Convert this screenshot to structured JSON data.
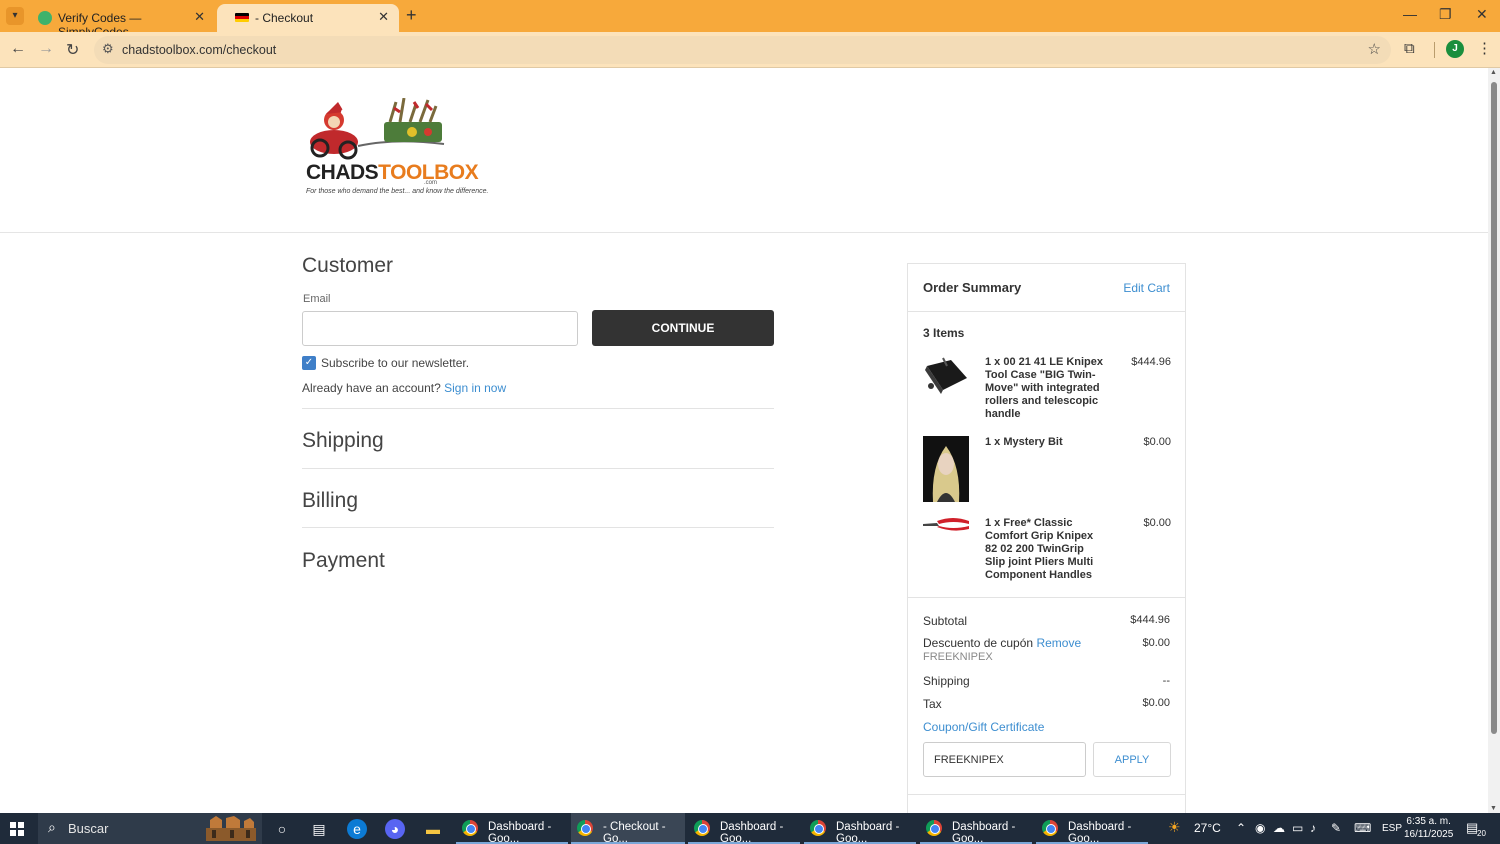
{
  "browser": {
    "tabs": [
      {
        "title": "Verify Codes — SimplyCodes",
        "active": false
      },
      {
        "title": "- Checkout",
        "active": true
      }
    ],
    "new_tab": "+",
    "url": "chadstoolbox.com/checkout",
    "profile_initial": "J",
    "window_controls": {
      "minimize": "—",
      "maximize": "❐",
      "close": "✕"
    }
  },
  "logo": {
    "brand_dark": "CHADS",
    "brand_orange": "TOOLBOX",
    "com": ".com",
    "tagline": "For those who demand the best... and know the difference."
  },
  "customer": {
    "heading": "Customer",
    "email_label": "Email",
    "email_value": "",
    "continue_label": "CONTINUE",
    "newsletter_label": "Subscribe to our newsletter.",
    "newsletter_checked": true,
    "account_text": "Already have an account?",
    "sign_in_label": "Sign in now"
  },
  "sections": {
    "shipping": "Shipping",
    "billing": "Billing",
    "payment": "Payment"
  },
  "summary": {
    "title": "Order Summary",
    "edit_cart": "Edit Cart",
    "items_count": "3 Items",
    "items": [
      {
        "name": "1 x 00 21 41 LE Knipex Tool Case \"BIG Twin-Move\" with integrated rollers and telescopic handle",
        "price": "$444.96"
      },
      {
        "name": "1 x Mystery Bit",
        "price": "$0.00"
      },
      {
        "name": "1 x Free* Classic Comfort Grip Knipex 82 02 200 TwinGrip Slip joint Pliers Multi Component Handles",
        "price": "$0.00"
      }
    ],
    "subtotal_label": "Subtotal",
    "subtotal_value": "$444.96",
    "discount_label": "Descuento de cupón",
    "discount_remove": "Remove",
    "discount_value": "$0.00",
    "discount_code": "FREEKNIPEX",
    "shipping_label": "Shipping",
    "shipping_value": "--",
    "tax_label": "Tax",
    "tax_value": "$0.00",
    "coupon_link": "Coupon/Gift Certificate",
    "coupon_input_value": "FREEKNIPEX",
    "apply_label": "APPLY"
  },
  "taskbar": {
    "search_placeholder": "Buscar",
    "apps": [
      {
        "label": "Dashboard - Goo...",
        "active": false
      },
      {
        "label": "- Checkout - Go...",
        "active": true
      },
      {
        "label": "Dashboard - Goo...",
        "active": false
      },
      {
        "label": "Dashboard - Goo...",
        "active": false
      },
      {
        "label": "Dashboard - Goo...",
        "active": false
      },
      {
        "label": "Dashboard - Goo...",
        "active": false
      }
    ],
    "temperature": "27°C",
    "language": "ESP",
    "time": "6:35 a. m.",
    "date": "16/11/2025",
    "notifications": "20"
  },
  "colors": {
    "tabbar": "#f7a93b",
    "toolbar": "#fce3bb",
    "link": "#3d8ed0",
    "button_dark": "#333333",
    "checkbox": "#3f7fc8",
    "taskbar": "#1f2b3a"
  }
}
